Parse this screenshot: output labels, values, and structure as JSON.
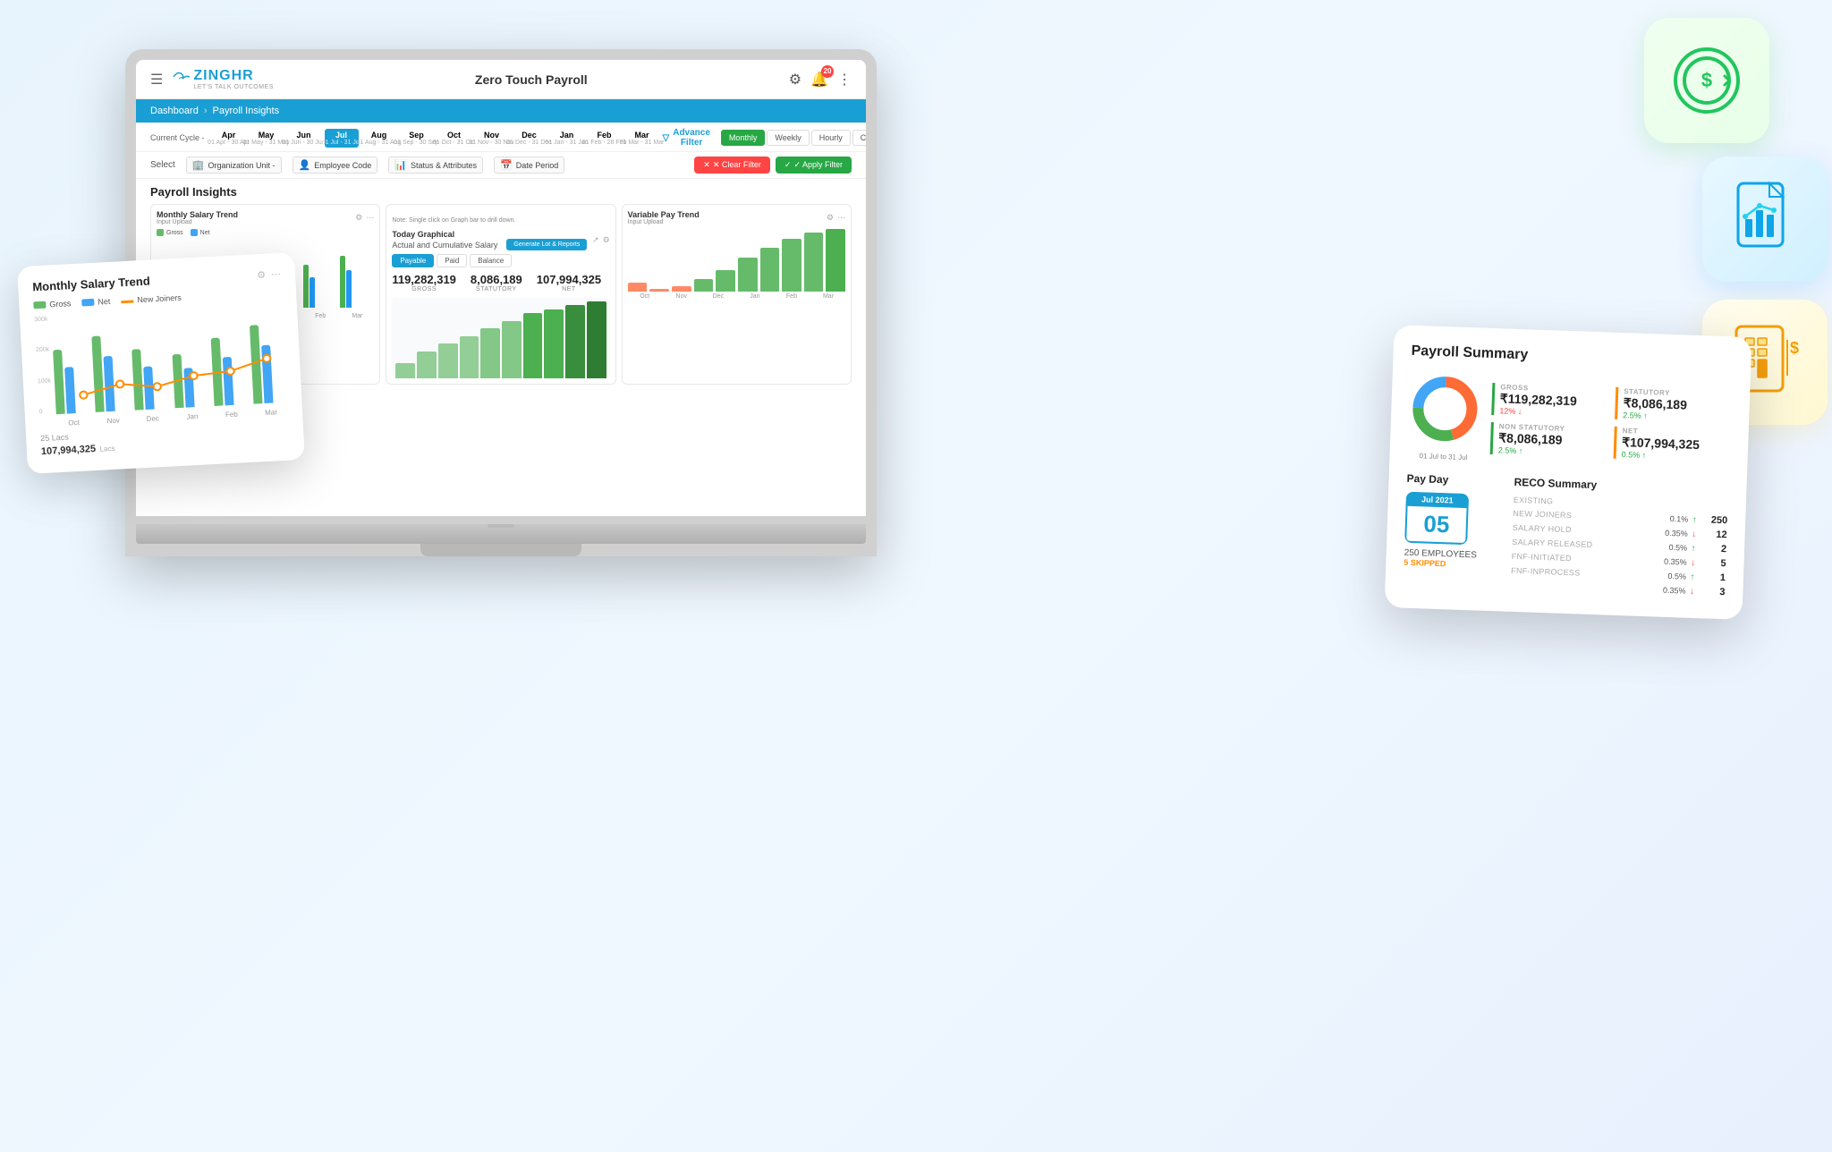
{
  "app": {
    "title": "Zero Touch Payroll",
    "logo": "ZINGHR",
    "logo_sub": "LET'S TALK OUTCOMES"
  },
  "header": {
    "hamburger": "☰",
    "settings_icon": "⚙",
    "notification_icon": "🔔",
    "notification_count": "20",
    "more_icon": "⋮"
  },
  "breadcrumb": {
    "home": "Dashboard",
    "separator": "›",
    "current": "Payroll Insights"
  },
  "timeline": {
    "label": "Current Cycle -",
    "months": [
      {
        "name": "Apr",
        "range": "01 Apr - 30 Apr"
      },
      {
        "name": "May",
        "range": "01 May - 31 May"
      },
      {
        "name": "Jun",
        "range": "01 Jun - 30 Jun"
      },
      {
        "name": "Jul",
        "range": "01 Jul - 31 Jul",
        "active": true
      },
      {
        "name": "Aug",
        "range": "01 Aug - 31 Aug"
      },
      {
        "name": "Sep",
        "range": "01 Sep - 30 Sep"
      },
      {
        "name": "Oct",
        "range": "01 Oct - 31 Oct"
      },
      {
        "name": "Nov",
        "range": "01 Nov - 30 Nov"
      },
      {
        "name": "Dec",
        "range": "01 Dec - 31 Dec"
      },
      {
        "name": "Jan",
        "range": "01 Jan - 31 Jan"
      },
      {
        "name": "Feb",
        "range": "01 Feb - 28 Feb"
      },
      {
        "name": "Mar",
        "range": "01 Mar - 31 Mar"
      }
    ],
    "advance_filter": "Advance Filter",
    "view_buttons": [
      "Monthly",
      "Weekly",
      "Hourly",
      "Custom"
    ]
  },
  "filters": {
    "select_label": "Select",
    "items": [
      {
        "icon": "🏢",
        "label": "Organization Unit -"
      },
      {
        "icon": "👤",
        "label": "Employee Code"
      },
      {
        "icon": "📊",
        "label": "Status & Attributes"
      },
      {
        "icon": "📅",
        "label": "Date Period"
      }
    ],
    "clear_btn": "✕ Clear Filter",
    "apply_btn": "✓ Apply Filter"
  },
  "insights": {
    "title": "Payroll Insights",
    "charts": [
      {
        "title": "Monthly Salary Trend",
        "sub": "Input Upload",
        "note": "Note: Single click on Graph bar to drill down.",
        "legends": [
          "Gross",
          "Net"
        ],
        "months": [
          "Oct",
          "Nov",
          "Dec",
          "Jan",
          "Feb",
          "Mar"
        ],
        "gross_data": [
          75,
          65,
          70,
          62,
          68,
          80
        ],
        "net_data": [
          55,
          45,
          50,
          42,
          48,
          58
        ]
      },
      {
        "title": "Today Graphical",
        "sub": "Actual and Cumulative Salary",
        "tabs": [
          "Payable",
          "Paid",
          "Balance"
        ],
        "gross_value": "119,282,319",
        "gross_label": "GROSS",
        "statutory_value": "8,086,189",
        "statutory_label": "STATUTORY",
        "net_value": "107,994,325",
        "net_label": "NET"
      },
      {
        "title": "Variable Pay Trend",
        "sub": "Input Upload",
        "months": [
          "Oct",
          "Nov",
          "Dec",
          "Jan",
          "Feb",
          "Mar"
        ]
      }
    ]
  },
  "monthly_card": {
    "title": "Monthly Salary Trend",
    "legends": [
      "Gross",
      "Net",
      "New Joiners"
    ],
    "y_labels": [
      "300k",
      "200k",
      "100k",
      "0"
    ],
    "months": [
      "Oct",
      "Nov",
      "Dec",
      "Jan",
      "Feb",
      "Mar"
    ],
    "gross_bars": [
      72,
      85,
      68,
      60,
      76,
      88
    ],
    "net_bars": [
      52,
      62,
      48,
      44,
      54,
      65
    ],
    "bottom_value": "107,994,325",
    "bottom_sub": "Lacs",
    "bottom_extra": "25 Lacs"
  },
  "payroll_summary": {
    "title": "Payroll Summary",
    "date_range": "01 Jul to 31 Jul",
    "donut": {
      "segments": [
        {
          "color": "#FF6B35",
          "pct": 45
        },
        {
          "color": "#4CAF50",
          "pct": 30
        },
        {
          "color": "#42A5F5",
          "pct": 25
        }
      ]
    },
    "stats": [
      {
        "category": "GROSS",
        "value": "₹119,282,319",
        "change": "12%",
        "direction": "down",
        "border_color": "#4CAF50"
      },
      {
        "category": "STATUTORY",
        "value": "₹8,086,189",
        "change": "2.5%",
        "direction": "up",
        "border_color": "#FF8C00"
      },
      {
        "category": "NON STATUTORY",
        "value": "₹8,086,189",
        "change": "2.5%",
        "direction": "up",
        "border_color": "#4CAF50"
      },
      {
        "category": "NET",
        "value": "₹107,994,325",
        "change": "0.5%",
        "direction": "up",
        "border_color": "#FF8C00"
      }
    ]
  },
  "payday": {
    "title": "Pay Day",
    "month": "Jul 2021",
    "day": "05",
    "employees": "250 EMPLOYEES",
    "skipped": "5 SKIPPED"
  },
  "reco_summary": {
    "title": "RECO Summary",
    "rows": [
      {
        "label": "EXISTING",
        "pct": "",
        "direction": "",
        "value": ""
      },
      {
        "label": "NEW JOINERS",
        "pct": "0.1%",
        "direction": "up",
        "value": "250"
      },
      {
        "label": "SALARY HOLD",
        "pct": "0.35%",
        "direction": "down",
        "value": "12"
      },
      {
        "label": "SALARY RELEASED",
        "pct": "0.5%",
        "direction": "up",
        "value": "2"
      },
      {
        "label": "FNF-INITIATED",
        "pct": "0.35%",
        "direction": "down",
        "value": "5"
      },
      {
        "label": "FNF-INPROCESS",
        "pct": "0.5%",
        "direction": "up",
        "value": "1"
      },
      {
        "label": "",
        "pct": "0.35%",
        "direction": "down",
        "value": "3"
      }
    ]
  },
  "colors": {
    "primary": "#1a9fd4",
    "success": "#28a745",
    "danger": "#ff4444",
    "orange": "#ff8c00",
    "gross_bar": "#66BB6A",
    "net_bar": "#42A5F5"
  }
}
